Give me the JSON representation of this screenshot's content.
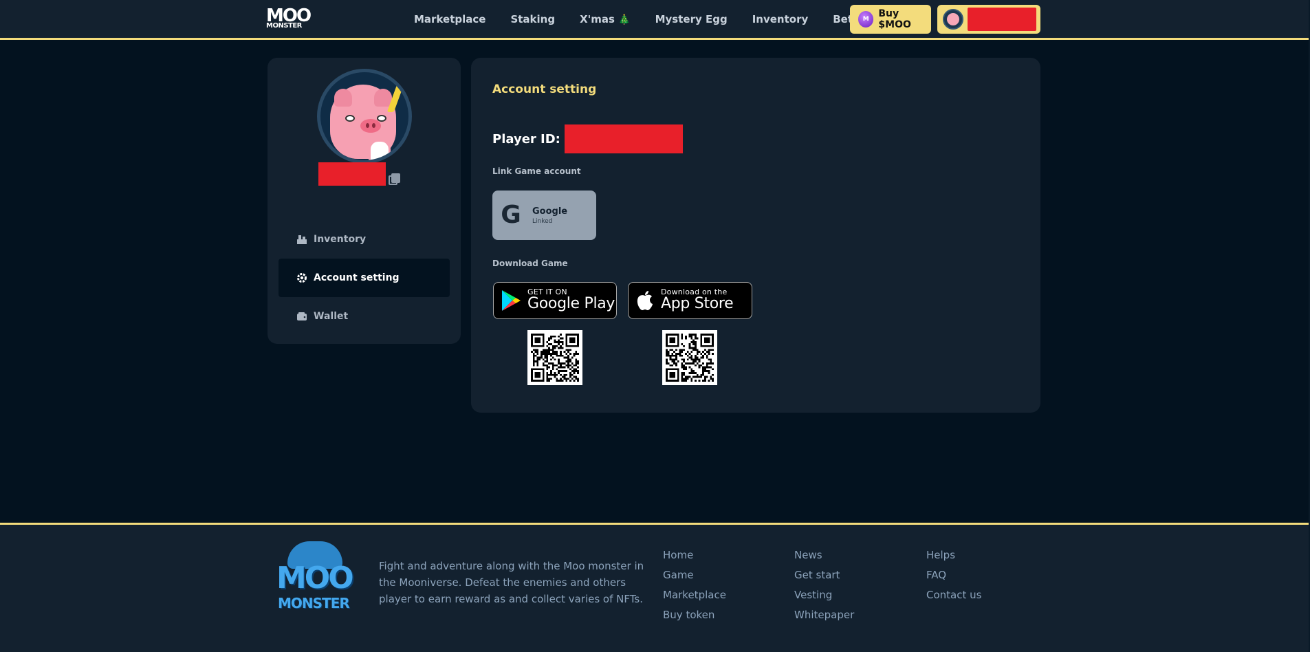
{
  "header": {
    "logo_line1": "MOO",
    "logo_line2": "MONSTER",
    "nav": [
      {
        "label": "Marketplace",
        "emoji": ""
      },
      {
        "label": "Staking",
        "emoji": ""
      },
      {
        "label": "X'mas",
        "emoji": "🎄"
      },
      {
        "label": "Mystery Egg",
        "emoji": ""
      },
      {
        "label": "Inventory",
        "emoji": ""
      },
      {
        "label": "Beta Test",
        "emoji": "🎲"
      }
    ],
    "buy_label": "Buy $MOO",
    "buy_coin_text": "M"
  },
  "sidebar": {
    "menu": [
      {
        "label": "Inventory",
        "icon": "inventory-icon",
        "active": false
      },
      {
        "label": "Account setting",
        "icon": "gear-icon",
        "active": true
      },
      {
        "label": "Wallet",
        "icon": "wallet-icon",
        "active": false
      }
    ]
  },
  "main": {
    "title": "Account setting",
    "player_id_label": "Player ID:",
    "link_label": "Link Game account",
    "google": {
      "name": "Google",
      "status": "Linked",
      "icon_glyph": "G"
    },
    "download_label": "Download Game",
    "google_play": {
      "small": "GET IT ON",
      "big": "Google Play"
    },
    "app_store": {
      "small": "Download on the",
      "big": "App Store"
    }
  },
  "footer": {
    "description": "Fight and adventure along with the Moo monster in the Mooniverse. Defeat the enemies and others player to earn reward as and collect varies of NFTs.",
    "col1": [
      "Home",
      "Game",
      "Marketplace",
      "Buy token"
    ],
    "col2": [
      "News",
      "Get start",
      "Vesting",
      "Whitepaper"
    ],
    "col3": [
      "Helps",
      "FAQ",
      "Contact us"
    ],
    "logo_line1": "MOO",
    "logo_line2": "MONSTER"
  },
  "colors": {
    "accent": "#f3dc7c",
    "panel": "#13212f",
    "background": "#03121f",
    "redaction": "#e8202a"
  }
}
